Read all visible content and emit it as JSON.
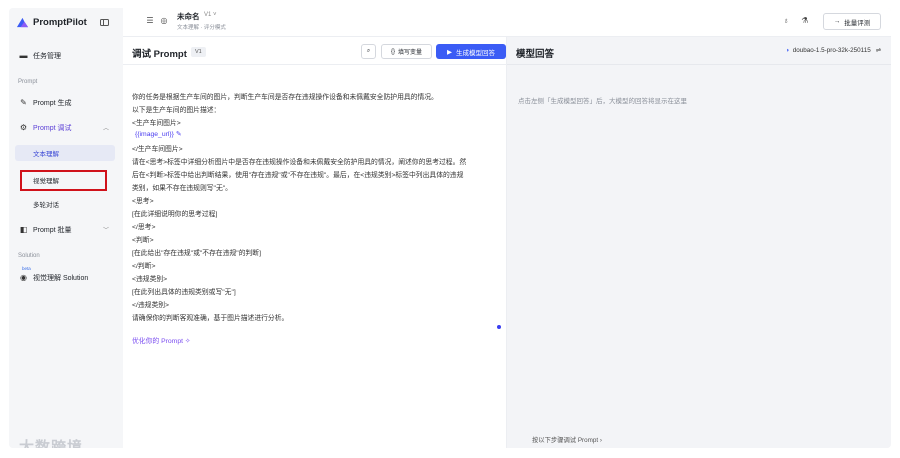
{
  "brand": {
    "name": "PromptPilot"
  },
  "sidebar": {
    "task_mgmt": "任务管理",
    "group_prompt": "Prompt",
    "prompt_gen": "Prompt 生成",
    "prompt_debug": "Prompt 调试",
    "sub_items": [
      "文本理解",
      "视觉理解",
      "多轮对话"
    ],
    "prompt_batch": "Prompt 批量",
    "group_solution": "Solution",
    "beta": "beta",
    "vision_solution": "视觉理解 Solution"
  },
  "topbar": {
    "doc_title": "未命名",
    "doc_version": "V1",
    "doc_sub": "文本理解 · 评分模式",
    "eval_label": "批量评测"
  },
  "left_pane": {
    "title": "调试 Prompt",
    "version": "V1",
    "fill_var": "填写变量",
    "generate": "生成模型回答",
    "lines": [
      "你的任务是根据生产车间的图片，判断生产车间是否存在违规操作设备和未佩戴安全防护用具的情况。",
      "以下是生产车间的图片描述：",
      "<生产车间图片>",
      "{{image_url}}",
      "</生产车间图片>",
      "请在<思考>标签中详细分析图片中是否存在违规操作设备和未佩戴安全防护用具的情况，阐述你的思考过程。然",
      "后在<判断>标签中给出判断结果，使用\"存在违规\"或\"不存在违规\"。最后，在<违规类别>标签中列出具体的违规",
      "类别，如果不存在违规则写\"无\"。",
      "<思考>",
      "[在此详细说明你的思考过程]",
      "</思考>",
      "<判断>",
      "[在此给出\"存在违规\"或\"不存在违规\"的判断]",
      "</判断>",
      "<违规类别>",
      "[在此列出具体的违规类别或写\"无\"]",
      "</违规类别>",
      "请确保你的判断客观准确，基于图片描述进行分析。"
    ],
    "optimize": "优化你的 Prompt"
  },
  "right_pane": {
    "title": "模型回答",
    "model": "doubao-1.5-pro-32k-250115",
    "hint": "点击左侧「生成模型回答」后，大模型的回答将显示在这里",
    "footer_hint": "按以下步骤调试 Prompt"
  },
  "watermark": "大数跨境"
}
